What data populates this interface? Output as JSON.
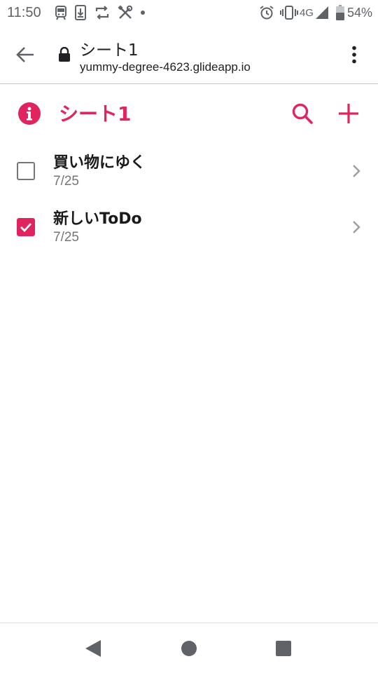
{
  "status_bar": {
    "time": "11:50",
    "network": "4G",
    "battery": "54%"
  },
  "browser": {
    "title": "シート1",
    "url": "yummy-degree-4623.glideapp.io"
  },
  "app": {
    "title": "シート1",
    "accent_color": "#e0245e"
  },
  "todos": [
    {
      "title": "買い物にゆく",
      "date": "7/25",
      "checked": false
    },
    {
      "title": "新しいToDo",
      "date": "7/25",
      "checked": true
    }
  ],
  "icons": {
    "status_left": [
      "train-icon",
      "download-icon",
      "sync-icon",
      "tools-icon",
      "dot-icon"
    ],
    "status_right": [
      "alarm-icon",
      "vibrate-icon",
      "signal-icon",
      "battery-icon"
    ],
    "browser": [
      "back-arrow-icon",
      "lock-icon",
      "more-vert-icon"
    ],
    "header": [
      "info-icon",
      "search-icon",
      "plus-icon"
    ],
    "nav": [
      "nav-back-icon",
      "nav-home-icon",
      "nav-recents-icon"
    ]
  }
}
